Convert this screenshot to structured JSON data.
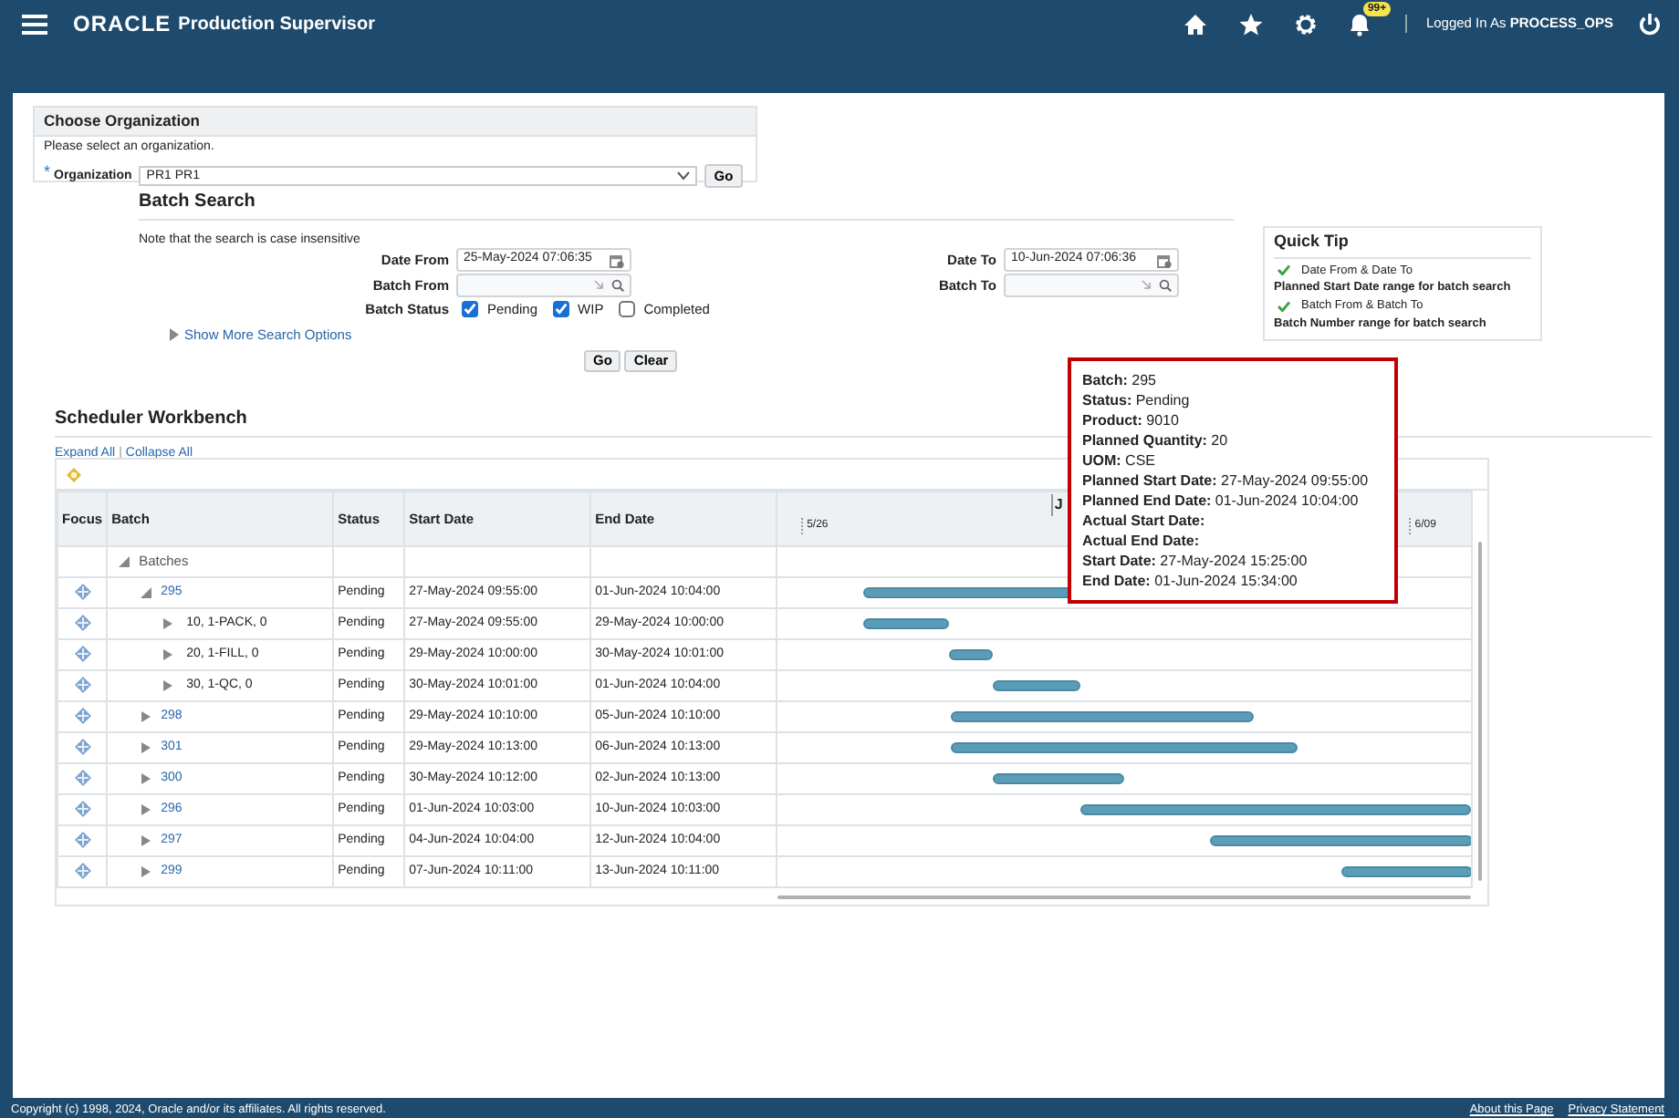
{
  "header": {
    "logo": "ORACLE",
    "title": "Production Supervisor",
    "notification_badge": "99+",
    "user_label": "Logged In As",
    "user": "PROCESS_OPS"
  },
  "organization": {
    "title": "Choose Organization",
    "instruction": "Please select an organization.",
    "required_mark": "*",
    "label": "Organization",
    "value": "PR1 PR1",
    "button": "Go"
  },
  "batch_search": {
    "title": "Batch Search",
    "note": "Note that the search is case insensitive",
    "fields": [
      {
        "label": "Date From",
        "value": "25-May-2024 07:06:35",
        "kind": "date"
      },
      {
        "label": "Date To",
        "value": "10-Jun-2024 07:06:36",
        "kind": "date"
      },
      {
        "label": "Batch From",
        "kind": "lookup"
      },
      {
        "label": "Batch To",
        "kind": "lookup"
      }
    ],
    "status_label": "Batch Status",
    "statuses": [
      {
        "label": "Pending",
        "checked": true
      },
      {
        "label": "WIP",
        "checked": true
      },
      {
        "label": "Completed",
        "checked": false
      }
    ],
    "more_options": "Show More Search Options",
    "buttons": [
      "Go",
      "Clear"
    ]
  },
  "quick_tip": {
    "title": "Quick Tip",
    "tips": [
      {
        "heading": "Date From & Date To",
        "text": "Planned Start Date range for batch search"
      },
      {
        "heading": "Batch From & Batch To",
        "text": "Batch Number range for batch search"
      }
    ]
  },
  "workbench": {
    "title": "Scheduler Workbench",
    "links": [
      "Expand All",
      "Collapse All"
    ],
    "separator": "|",
    "columns": [
      "Focus",
      "Batch",
      "Status",
      "Start Date",
      "End Date"
    ],
    "timeline": {
      "month": "J",
      "ticks": [
        "5/26",
        "6/09"
      ]
    },
    "rows": [
      {
        "kind": "group",
        "batch": "Batches",
        "expanded": true,
        "children": [
          {
            "kind": "batch",
            "batch": "295",
            "status": "Pending",
            "start": "27-May-2024 09:55:00",
            "end": "01-Jun-2024 10:04:00",
            "expanded": true,
            "children": [
              {
                "kind": "step",
                "batch": "10, 1-PACK, 0",
                "status": "Pending",
                "start": "27-May-2024 09:55:00",
                "end": "29-May-2024 10:00:00",
                "expanded": false
              },
              {
                "kind": "step",
                "batch": "20, 1-FILL, 0",
                "status": "Pending",
                "start": "29-May-2024 10:00:00",
                "end": "30-May-2024 10:01:00",
                "expanded": false
              },
              {
                "kind": "step",
                "batch": "30, 1-QC, 0",
                "status": "Pending",
                "start": "30-May-2024 10:01:00",
                "end": "01-Jun-2024 10:04:00",
                "expanded": false
              }
            ]
          },
          {
            "kind": "batch",
            "batch": "298",
            "status": "Pending",
            "start": "29-May-2024 10:10:00",
            "end": "05-Jun-2024 10:10:00",
            "expanded": false
          },
          {
            "kind": "batch",
            "batch": "301",
            "status": "Pending",
            "start": "29-May-2024 10:13:00",
            "end": "06-Jun-2024 10:13:00",
            "expanded": false
          },
          {
            "kind": "batch",
            "batch": "300",
            "status": "Pending",
            "start": "30-May-2024 10:12:00",
            "end": "02-Jun-2024 10:13:00",
            "expanded": false
          },
          {
            "kind": "batch",
            "batch": "296",
            "status": "Pending",
            "start": "01-Jun-2024 10:03:00",
            "end": "10-Jun-2024 10:03:00",
            "expanded": false
          },
          {
            "kind": "batch",
            "batch": "297",
            "status": "Pending",
            "start": "04-Jun-2024 10:04:00",
            "end": "12-Jun-2024 10:04:00",
            "expanded": false
          },
          {
            "kind": "batch",
            "batch": "299",
            "status": "Pending",
            "start": "07-Jun-2024 10:11:00",
            "end": "13-Jun-2024 10:11:00",
            "expanded": false
          }
        ]
      }
    ]
  },
  "tooltip": {
    "lines": [
      {
        "label": "Batch:",
        "value": "295"
      },
      {
        "label": "Status:",
        "value": "Pending"
      },
      {
        "label": "Product:",
        "value": "9010"
      },
      {
        "label": "Planned Quantity:",
        "value": "20"
      },
      {
        "label": "UOM:",
        "value": "CSE"
      },
      {
        "label": "Planned Start Date:",
        "value": "27-May-2024 09:55:00"
      },
      {
        "label": "Planned End Date:",
        "value": "01-Jun-2024 10:04:00"
      },
      {
        "label": "Actual Start Date:"
      },
      {
        "label": "Actual End Date:"
      },
      {
        "label": "Start Date:",
        "value": "27-May-2024 15:25:00"
      },
      {
        "label": "End Date:",
        "value": "01-Jun-2024 15:34:00"
      }
    ]
  },
  "footer": {
    "copyright": "Copyright (c) 1998, 2024, Oracle and/or its affiliates. All rights reserved.",
    "links": [
      "About this Page",
      "Privacy Statement"
    ]
  }
}
